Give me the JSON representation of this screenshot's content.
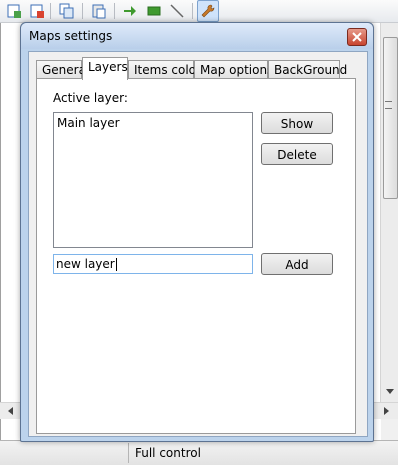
{
  "toolbar": {
    "icons": [
      "new-map-icon",
      "delete-map-icon",
      "copy-icon",
      "paste-icon",
      "arrow-right-icon",
      "rectangle-icon",
      "line-icon",
      "wrench-icon"
    ]
  },
  "dialog": {
    "title": "Maps settings",
    "tabs": [
      "General",
      "Layers",
      "Items color",
      "Map options",
      "BackGround"
    ],
    "selected_tab": "Layers",
    "active_layer_label": "Active layer:",
    "layers": [
      "Main layer"
    ],
    "buttons": {
      "show": "Show",
      "delete": "Delete",
      "add": "Add"
    },
    "new_layer_value": "new layer"
  },
  "status_bar": {
    "text": "Full control"
  },
  "colors": {
    "titlebar": "#b9cfea",
    "close": "#c8442f",
    "input_focus": "#7eb4ea"
  }
}
